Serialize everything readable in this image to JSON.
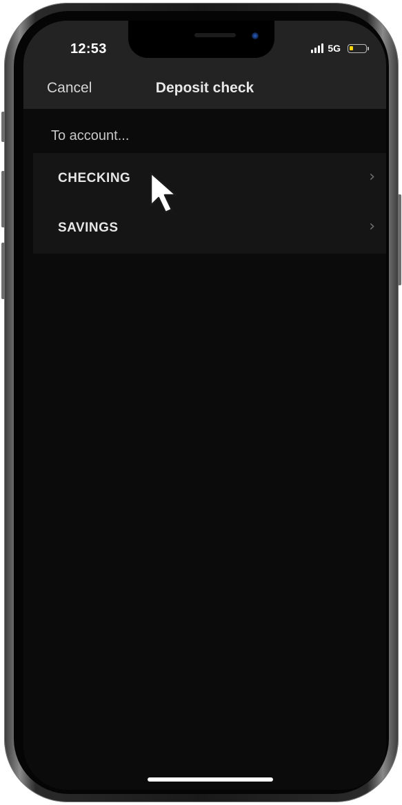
{
  "status_bar": {
    "time": "12:53",
    "network": "5G",
    "battery_color": "#ffd60a",
    "icons": [
      "signal-icon",
      "battery-icon"
    ]
  },
  "nav": {
    "cancel_label": "Cancel",
    "title": "Deposit check"
  },
  "section": {
    "header": "To account..."
  },
  "accounts": [
    {
      "label": "CHECKING",
      "icon": "chevron-right-icon"
    },
    {
      "label": "SAVINGS",
      "icon": "chevron-right-icon"
    }
  ],
  "colors": {
    "background": "#0b0b0b",
    "header_bg": "#232323",
    "list_bg": "#151515",
    "text_primary": "#e6e6e6",
    "chevron": "#6f6f6f"
  }
}
